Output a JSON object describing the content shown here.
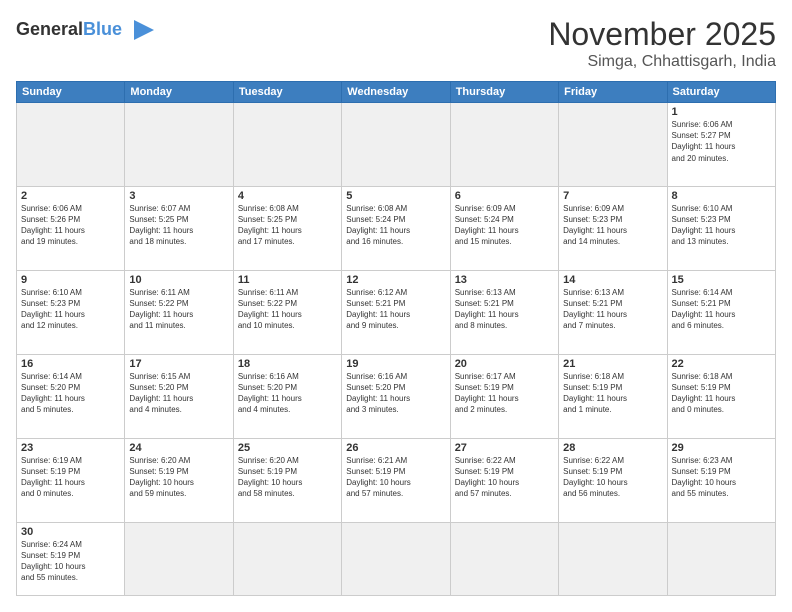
{
  "logo": {
    "text_general": "General",
    "text_blue": "Blue"
  },
  "title": "November 2025",
  "location": "Simga, Chhattisgarh, India",
  "days_of_week": [
    "Sunday",
    "Monday",
    "Tuesday",
    "Wednesday",
    "Thursday",
    "Friday",
    "Saturday"
  ],
  "weeks": [
    [
      {
        "day": "",
        "empty": true
      },
      {
        "day": "",
        "empty": true
      },
      {
        "day": "",
        "empty": true
      },
      {
        "day": "",
        "empty": true
      },
      {
        "day": "",
        "empty": true
      },
      {
        "day": "",
        "empty": true
      },
      {
        "day": "1",
        "info": "Sunrise: 6:06 AM\nSunset: 5:27 PM\nDaylight: 11 hours\nand 20 minutes."
      }
    ],
    [
      {
        "day": "2",
        "info": "Sunrise: 6:06 AM\nSunset: 5:26 PM\nDaylight: 11 hours\nand 19 minutes."
      },
      {
        "day": "3",
        "info": "Sunrise: 6:07 AM\nSunset: 5:25 PM\nDaylight: 11 hours\nand 18 minutes."
      },
      {
        "day": "4",
        "info": "Sunrise: 6:08 AM\nSunset: 5:25 PM\nDaylight: 11 hours\nand 17 minutes."
      },
      {
        "day": "5",
        "info": "Sunrise: 6:08 AM\nSunset: 5:24 PM\nDaylight: 11 hours\nand 16 minutes."
      },
      {
        "day": "6",
        "info": "Sunrise: 6:09 AM\nSunset: 5:24 PM\nDaylight: 11 hours\nand 15 minutes."
      },
      {
        "day": "7",
        "info": "Sunrise: 6:09 AM\nSunset: 5:23 PM\nDaylight: 11 hours\nand 14 minutes."
      },
      {
        "day": "8",
        "info": "Sunrise: 6:10 AM\nSunset: 5:23 PM\nDaylight: 11 hours\nand 13 minutes."
      }
    ],
    [
      {
        "day": "9",
        "info": "Sunrise: 6:10 AM\nSunset: 5:23 PM\nDaylight: 11 hours\nand 12 minutes."
      },
      {
        "day": "10",
        "info": "Sunrise: 6:11 AM\nSunset: 5:22 PM\nDaylight: 11 hours\nand 11 minutes."
      },
      {
        "day": "11",
        "info": "Sunrise: 6:11 AM\nSunset: 5:22 PM\nDaylight: 11 hours\nand 10 minutes."
      },
      {
        "day": "12",
        "info": "Sunrise: 6:12 AM\nSunset: 5:21 PM\nDaylight: 11 hours\nand 9 minutes."
      },
      {
        "day": "13",
        "info": "Sunrise: 6:13 AM\nSunset: 5:21 PM\nDaylight: 11 hours\nand 8 minutes."
      },
      {
        "day": "14",
        "info": "Sunrise: 6:13 AM\nSunset: 5:21 PM\nDaylight: 11 hours\nand 7 minutes."
      },
      {
        "day": "15",
        "info": "Sunrise: 6:14 AM\nSunset: 5:21 PM\nDaylight: 11 hours\nand 6 minutes."
      }
    ],
    [
      {
        "day": "16",
        "info": "Sunrise: 6:14 AM\nSunset: 5:20 PM\nDaylight: 11 hours\nand 5 minutes."
      },
      {
        "day": "17",
        "info": "Sunrise: 6:15 AM\nSunset: 5:20 PM\nDaylight: 11 hours\nand 4 minutes."
      },
      {
        "day": "18",
        "info": "Sunrise: 6:16 AM\nSunset: 5:20 PM\nDaylight: 11 hours\nand 4 minutes."
      },
      {
        "day": "19",
        "info": "Sunrise: 6:16 AM\nSunset: 5:20 PM\nDaylight: 11 hours\nand 3 minutes."
      },
      {
        "day": "20",
        "info": "Sunrise: 6:17 AM\nSunset: 5:19 PM\nDaylight: 11 hours\nand 2 minutes."
      },
      {
        "day": "21",
        "info": "Sunrise: 6:18 AM\nSunset: 5:19 PM\nDaylight: 11 hours\nand 1 minute."
      },
      {
        "day": "22",
        "info": "Sunrise: 6:18 AM\nSunset: 5:19 PM\nDaylight: 11 hours\nand 0 minutes."
      }
    ],
    [
      {
        "day": "23",
        "info": "Sunrise: 6:19 AM\nSunset: 5:19 PM\nDaylight: 11 hours\nand 0 minutes."
      },
      {
        "day": "24",
        "info": "Sunrise: 6:20 AM\nSunset: 5:19 PM\nDaylight: 10 hours\nand 59 minutes."
      },
      {
        "day": "25",
        "info": "Sunrise: 6:20 AM\nSunset: 5:19 PM\nDaylight: 10 hours\nand 58 minutes."
      },
      {
        "day": "26",
        "info": "Sunrise: 6:21 AM\nSunset: 5:19 PM\nDaylight: 10 hours\nand 57 minutes."
      },
      {
        "day": "27",
        "info": "Sunrise: 6:22 AM\nSunset: 5:19 PM\nDaylight: 10 hours\nand 57 minutes."
      },
      {
        "day": "28",
        "info": "Sunrise: 6:22 AM\nSunset: 5:19 PM\nDaylight: 10 hours\nand 56 minutes."
      },
      {
        "day": "29",
        "info": "Sunrise: 6:23 AM\nSunset: 5:19 PM\nDaylight: 10 hours\nand 55 minutes."
      }
    ],
    [
      {
        "day": "30",
        "info": "Sunrise: 6:24 AM\nSunset: 5:19 PM\nDaylight: 10 hours\nand 55 minutes.",
        "last": true
      },
      {
        "day": "",
        "empty": true,
        "last": true
      },
      {
        "day": "",
        "empty": true,
        "last": true
      },
      {
        "day": "",
        "empty": true,
        "last": true
      },
      {
        "day": "",
        "empty": true,
        "last": true
      },
      {
        "day": "",
        "empty": true,
        "last": true
      },
      {
        "day": "",
        "empty": true,
        "last": true
      }
    ]
  ]
}
